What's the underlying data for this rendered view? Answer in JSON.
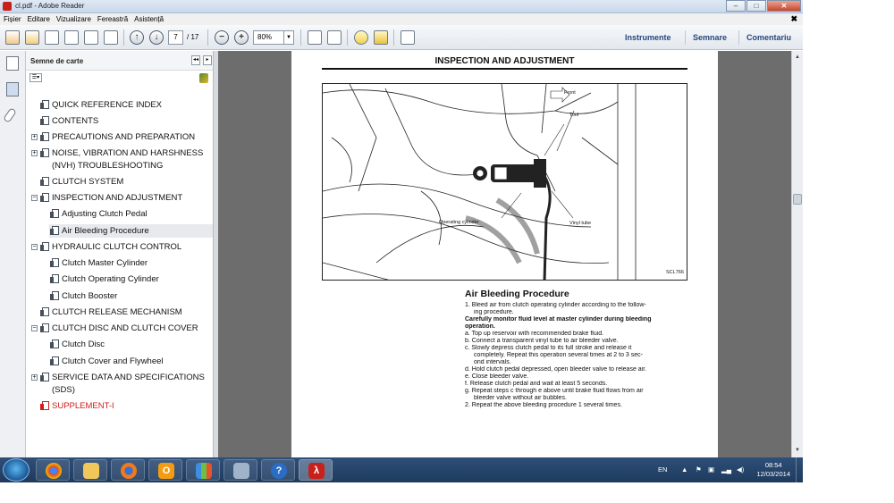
{
  "window": {
    "title": "cl.pdf - Adobe Reader",
    "buttons": {
      "minimize": "–",
      "maximize": "□",
      "close": "✕"
    }
  },
  "menu": {
    "items": [
      "Fișier",
      "Editare",
      "Vizualizare",
      "Fereastră",
      "Asistență"
    ],
    "close_doc": "✖"
  },
  "toolbar": {
    "page_current": "7",
    "page_total": "/ 17",
    "zoom": "80%",
    "right_tabs": [
      "Instrumente",
      "Semnare",
      "Comentariu"
    ]
  },
  "bookmarks": {
    "title": "Semne de carte",
    "items": [
      {
        "label": "QUICK REFERENCE INDEX"
      },
      {
        "label": "CONTENTS"
      },
      {
        "label": "PRECAUTIONS AND PREPARATION",
        "expand": "+"
      },
      {
        "label": "NOISE, VIBRATION AND HARSHNESS",
        "label2": "(NVH) TROUBLESHOOTING",
        "expand": "+"
      },
      {
        "label": "CLUTCH SYSTEM"
      },
      {
        "label": "INSPECTION AND ADJUSTMENT",
        "expand": "−"
      },
      {
        "label": "Adjusting Clutch Pedal"
      },
      {
        "label": "Air Bleeding Procedure"
      },
      {
        "label": "HYDRAULIC CLUTCH CONTROL",
        "expand": "−"
      },
      {
        "label": "Clutch Master Cylinder"
      },
      {
        "label": "Clutch Operating Cylinder"
      },
      {
        "label": "Clutch Booster"
      },
      {
        "label": "CLUTCH RELEASE MECHANISM"
      },
      {
        "label": "CLUTCH DISC AND CLUTCH COVER",
        "expand": "−"
      },
      {
        "label": "Clutch Disc"
      },
      {
        "label": "Clutch Cover and Flywheel"
      },
      {
        "label": "SERVICE DATA AND SPECIFICATIONS",
        "label2": "(SDS)",
        "expand": "+"
      },
      {
        "label": "SUPPLEMENT-I"
      }
    ]
  },
  "document": {
    "header": "INSPECTION AND ADJUSTMENT",
    "figure": {
      "labels": {
        "front": "Front",
        "tool": "Tool",
        "operating_cylinder": "Operating cylinder",
        "vinyl_tube": "Vinyl tube",
        "code": "SCL766"
      }
    },
    "section_title": "Air Bleeding Procedure",
    "lines": [
      "1.  Bleed air from clutch operating cylinder according to the follow-",
      "ing procedure.",
      "Carefully monitor fluid level at master cylinder during bleeding",
      "operation.",
      "a.  Top up reservoir with recommended brake fluid.",
      "b.  Connect a transparent vinyl tube to air bleeder valve.",
      "c.  Slowly depress clutch pedal to its full stroke and release it",
      "completely. Repeat this operation several times at 2 to 3 sec-",
      "ond intervals.",
      "d.  Hold clutch pedal depressed, open bleeder valve to release air.",
      "e.  Close bleeder valve.",
      "f.   Release clutch pedal and wait at least 5 seconds.",
      "g.  Repeat steps c through e above until brake fluid flows from air",
      "bleeder valve without air bubbles.",
      "2.  Repeat the above bleeding procedure 1 several times."
    ]
  },
  "taskbar": {
    "apps": [
      "windows-start",
      "chrome",
      "file-explorer",
      "firefox",
      "outlook",
      "charts",
      "control-panel",
      "help",
      "adobe-reader"
    ],
    "tray": {
      "lang": "EN",
      "time": "08:54",
      "date": "12/03/2014"
    }
  },
  "colors": {
    "accent_blue": "#26477c",
    "link_red": "#d11b1b",
    "taskbar": "#1e3a5e"
  }
}
